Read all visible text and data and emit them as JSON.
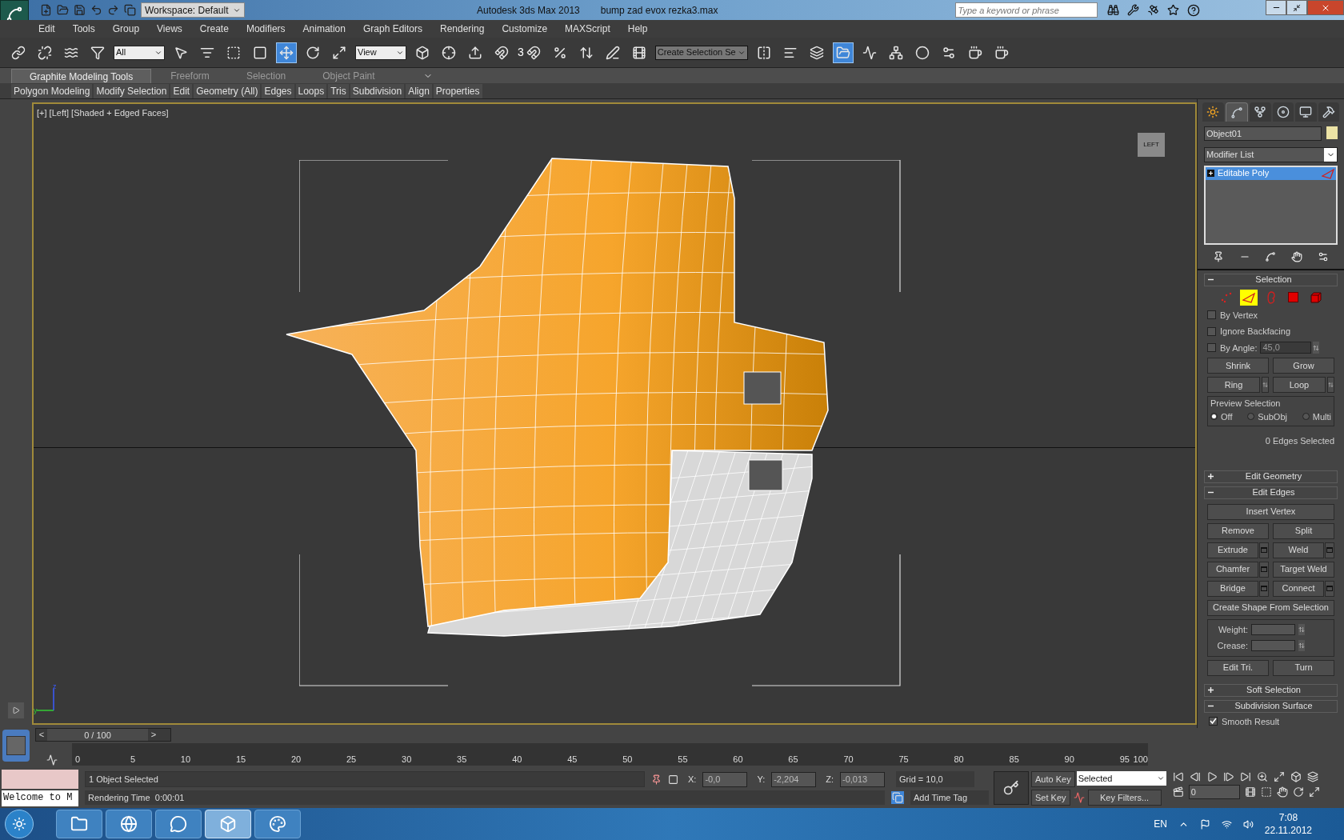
{
  "title_bar": {
    "workspace": "Workspace: Default",
    "title": "Autodesk 3ds Max  2013",
    "file": "bump zad evox rezka3.max",
    "search": {
      "placeholder": "Type a keyword or phrase"
    }
  },
  "menu": [
    "Edit",
    "Tools",
    "Group",
    "Views",
    "Create",
    "Modifiers",
    "Animation",
    "Graph Editors",
    "Rendering",
    "Customize",
    "MAXScript",
    "Help"
  ],
  "toolbar": {
    "selection_filter": "All",
    "reference_coord": "View",
    "snap_label": "3",
    "named_selection": "Create Selection Se",
    "buttons": [
      {
        "kind": "link",
        "selected": false
      },
      {
        "kind": "unlink",
        "selected": false
      },
      {
        "kind": "bind",
        "selected": false
      },
      {
        "kind": "filter",
        "selected": false
      },
      {
        "kind": "select",
        "selected": false
      },
      {
        "kind": "select-by-name",
        "selected": false
      },
      {
        "kind": "region",
        "selected": false
      },
      {
        "kind": "window",
        "selected": false
      },
      {
        "kind": "move",
        "selected": true
      },
      {
        "kind": "rotate",
        "selected": false
      },
      {
        "kind": "scale",
        "selected": false
      },
      {
        "kind": "reference",
        "selected": false
      },
      {
        "kind": "pivot",
        "selected": false
      },
      {
        "kind": "manipulate",
        "selected": false
      },
      {
        "kind": "snap",
        "selected": false
      },
      {
        "kind": "angle-snap",
        "selected": false
      },
      {
        "kind": "percent-snap",
        "selected": false
      },
      {
        "kind": "spinner-snap",
        "selected": false
      },
      {
        "kind": "edit-named",
        "selected": false
      },
      {
        "kind": "named",
        "selected": false
      },
      {
        "kind": "mirror",
        "selected": false
      },
      {
        "kind": "align",
        "selected": false
      },
      {
        "kind": "layers",
        "selected": false
      },
      {
        "kind": "explorer",
        "selected": true
      },
      {
        "kind": "curve",
        "selected": false
      },
      {
        "kind": "schematic",
        "selected": false
      },
      {
        "kind": "material",
        "selected": false
      },
      {
        "kind": "render-setup",
        "selected": false
      },
      {
        "kind": "render-frame",
        "selected": false
      },
      {
        "kind": "render",
        "selected": false
      }
    ]
  },
  "ribbon": {
    "tabs": [
      {
        "label": "Graphite Modeling Tools",
        "selected": true
      },
      {
        "label": "Freeform",
        "selected": false
      },
      {
        "label": "Selection",
        "selected": false
      },
      {
        "label": "Object Paint",
        "selected": false
      }
    ],
    "panels": [
      "Polygon Modeling",
      "Modify Selection",
      "Edit",
      "Geometry (All)",
      "Edges",
      "Loops",
      "Tris",
      "Subdivision",
      "Align",
      "Properties"
    ]
  },
  "viewport": {
    "label": "[+] [Left] [Shaded + Edged Faces]",
    "viewcube": "LEFT",
    "axes": [
      "z",
      "y"
    ]
  },
  "command_panel": {
    "tabs": [
      {
        "kind": "create",
        "selected": false
      },
      {
        "kind": "modify",
        "selected": true
      },
      {
        "kind": "hierarchy",
        "selected": false
      },
      {
        "kind": "motion",
        "selected": false
      },
      {
        "kind": "display",
        "selected": false
      },
      {
        "kind": "utilities",
        "selected": false
      }
    ],
    "object_name": "Object01",
    "modifier_list": "Modifier List",
    "stack": [
      {
        "label": "Editable Poly",
        "selected": true
      }
    ],
    "rollouts": [
      {
        "kind": "selection",
        "title": "Selection",
        "expanded": true,
        "subobjects": [
          {
            "kind": "vertex",
            "selected": false
          },
          {
            "kind": "edge",
            "selected": true
          },
          {
            "kind": "border",
            "selected": false
          },
          {
            "kind": "polygon",
            "selected": false
          },
          {
            "kind": "element",
            "selected": false
          }
        ],
        "checks": [
          {
            "label": "By Vertex",
            "checked": false
          },
          {
            "label": "Ignore Backfacing",
            "checked": false
          },
          {
            "label": "By Angle:",
            "checked": false
          }
        ],
        "angle": "45,0",
        "buttons": [
          "Shrink",
          "Grow"
        ],
        "spin_buttons": [
          "Ring",
          "Loop"
        ],
        "preview": {
          "title": "Preview Selection",
          "options": [
            {
              "label": "Off",
              "selected": true
            },
            {
              "label": "SubObj",
              "selected": false
            },
            {
              "label": "Multi",
              "selected": false
            }
          ]
        },
        "status": "0 Edges Selected"
      },
      {
        "title": "Edit Geometry",
        "expanded": false
      },
      {
        "kind": "edges",
        "title": "Edit Edges",
        "expanded": true,
        "wide": "Insert Vertex",
        "pairs": [
          [
            {
              "label": "Remove",
              "settings": false
            },
            {
              "label": "Split",
              "settings": false
            }
          ],
          [
            {
              "label": "Extrude",
              "settings": true
            },
            {
              "label": "Weld",
              "settings": true
            }
          ],
          [
            {
              "label": "Chamfer",
              "settings": true
            },
            {
              "label": "Target Weld",
              "settings": false
            }
          ],
          [
            {
              "label": "Bridge",
              "settings": true
            },
            {
              "label": "Connect",
              "settings": true
            }
          ]
        ],
        "wide2": "Create Shape From Selection",
        "spinners": [
          "Weight:",
          "Crease:"
        ],
        "last": [
          "Edit Tri.",
          "Turn"
        ]
      },
      {
        "title": "Soft Selection",
        "expanded": false
      },
      {
        "kind": "subdivision",
        "title": "Subdivision Surface",
        "expanded": true,
        "checks": [
          {
            "label": "Smooth Result",
            "checked": true
          }
        ]
      }
    ]
  },
  "timeline": {
    "prev": "<",
    "next": ">",
    "label": "0 / 100",
    "ticks": [
      "0",
      "5",
      "10",
      "15",
      "20",
      "25",
      "30",
      "35",
      "40",
      "45",
      "50",
      "55",
      "60",
      "65",
      "70",
      "75",
      "80",
      "85",
      "90",
      "95",
      "100"
    ]
  },
  "status_bar": {
    "listener": "Welcome to M",
    "selection_info": "1 Object Selected",
    "prompt": "Rendering Time  0:00:01",
    "coords": [
      {
        "axis": "X:",
        "value": "-0,0"
      },
      {
        "axis": "Y:",
        "value": "-2,204"
      },
      {
        "axis": "Z:",
        "value": "-0,013"
      }
    ],
    "grid": "Grid = 10,0",
    "time_tag": "Add Time Tag",
    "auto_key": "Auto Key",
    "set_key": "Set Key",
    "key_mode": "Selected",
    "key_filters": "Key Filters...",
    "frame": "0"
  },
  "taskbar": {
    "apps": [
      {
        "kind": "folder",
        "selected": false
      },
      {
        "kind": "browser",
        "selected": false
      },
      {
        "kind": "chat",
        "selected": false
      },
      {
        "kind": "max",
        "selected": true
      },
      {
        "kind": "paint",
        "selected": false
      }
    ],
    "language": "EN",
    "time": "7:08",
    "date": "22.11.2012"
  }
}
